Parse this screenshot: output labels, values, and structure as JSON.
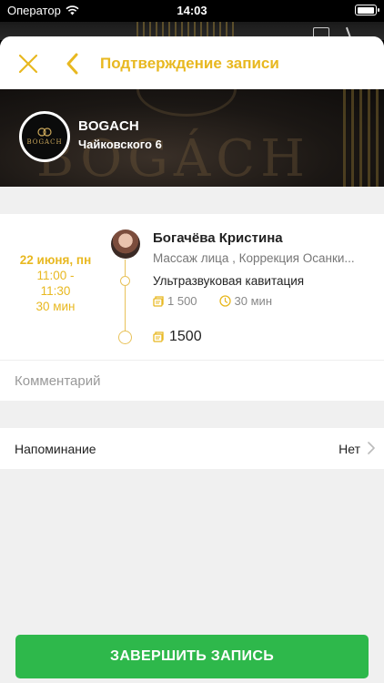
{
  "status_bar": {
    "carrier": "Оператор",
    "time": "14:03",
    "battery_level": 0.95
  },
  "navbar": {
    "title": "Подтверждение записи"
  },
  "salon": {
    "name": "BOGACH",
    "address": "Чайковского 6",
    "logo_text": "BOGACH",
    "background_word": "BOGÁCH"
  },
  "appointment": {
    "date": "22 июня, пн",
    "time_start": "11:00 -",
    "time_end": "11:30",
    "duration": "30 мин",
    "master_name": "Богачёва Кристина",
    "master_specialization": "Массаж лица , Коррекция Осанки...",
    "service_name": "Ультразвуковая кавитация",
    "service_price": "1 500",
    "service_duration": "30 мин",
    "total": "1500"
  },
  "comment": {
    "placeholder": "Комментарий"
  },
  "reminder": {
    "label": "Напоминание",
    "value": "Нет"
  },
  "finish_button": {
    "label": "ЗАВЕРШИТЬ ЗАПИСЬ"
  },
  "colors": {
    "accent": "#e8b820",
    "button": "#2eb84b"
  }
}
